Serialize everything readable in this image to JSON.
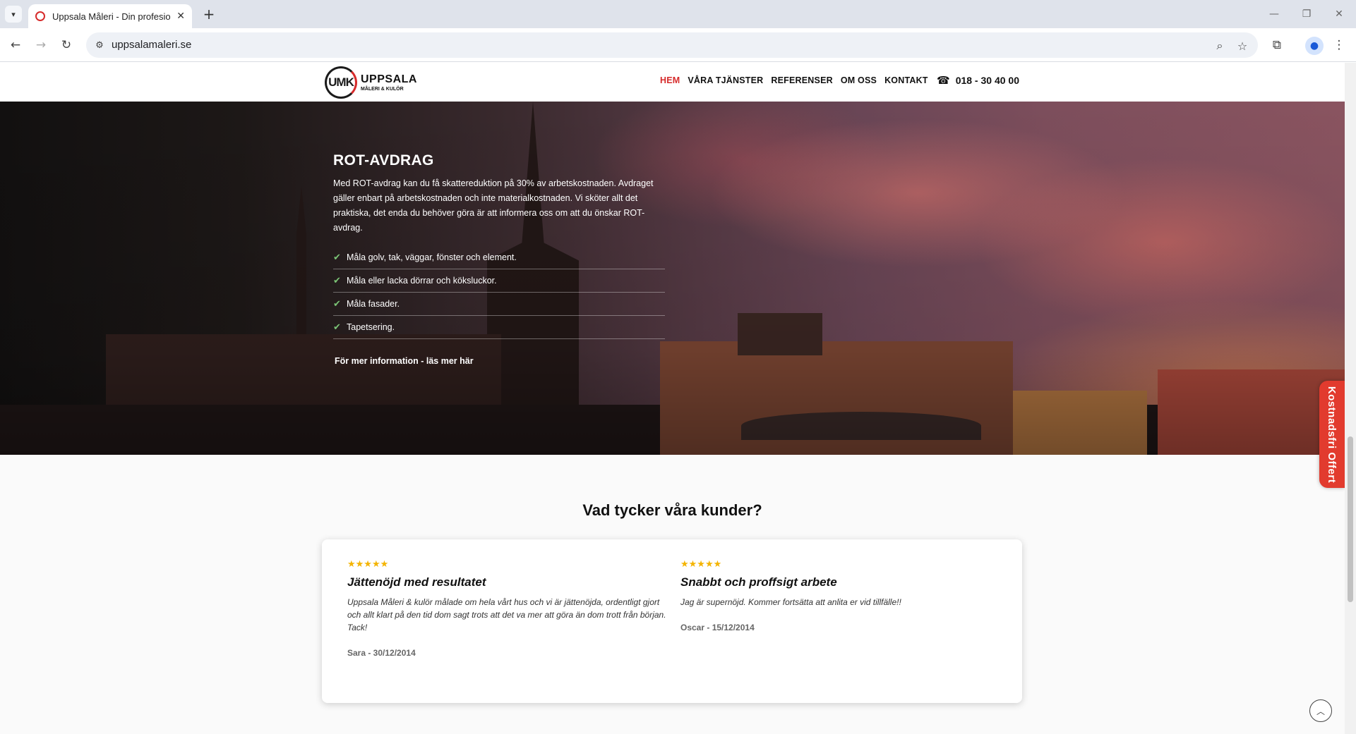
{
  "browser": {
    "tab_title": "Uppsala Måleri - Din profesionell",
    "url": "uppsalamaleri.se",
    "icons": {
      "tab_menu": "chevron-down-icon",
      "close_tab": "close-icon",
      "new_tab": "plus-icon",
      "back": "arrow-left-icon",
      "forward": "arrow-right-icon",
      "reload": "reload-icon",
      "site_info": "tune-icon",
      "zoom": "zoom-icon",
      "bookmark": "star-icon",
      "extensions": "puzzle-icon",
      "profile": "person-icon",
      "menu": "kebab-icon"
    }
  },
  "header": {
    "logo": {
      "mark": "UMK",
      "line1": "UPPSALA",
      "line2": "MÅLERI & KULÖR"
    },
    "nav": [
      {
        "label": "HEM",
        "active": true
      },
      {
        "label": "VÅRA TJÄNSTER",
        "active": false
      },
      {
        "label": "REFERENSER",
        "active": false
      },
      {
        "label": "OM OSS",
        "active": false
      },
      {
        "label": "KONTAKT",
        "active": false
      }
    ],
    "phone": "018 - 30 40 00",
    "accent_color": "#d62b2b"
  },
  "hero": {
    "title": "ROT-AVDRAG",
    "text": "Med ROT-avdrag kan du få skattereduktion på 30% av arbetskostnaden. Avdraget gäller enbart på arbetskostnaden och inte materialkostnaden. Vi sköter allt det praktiska, det enda du behöver göra är att informera oss om att du önskar ROT-avdrag.",
    "items": [
      "Måla golv, tak, väggar, fönster och element.",
      "Måla eller lacka dörrar och köksluckor.",
      "Måla fasader.",
      "Tapetsering."
    ],
    "more_link": "För mer information - läs mer här"
  },
  "side_tab": {
    "label": "Kostnadsfri Offert",
    "color": "#e23b2e"
  },
  "reviews": {
    "heading": "Vad tycker våra kunder?",
    "items": [
      {
        "stars": "★★★★★",
        "rating": 5,
        "title": "Jättenöjd med resultatet",
        "text": "Uppsala Måleri & kulör målade om hela vårt hus och vi är jättenöjda, ordentligt gjort och allt klart på den tid dom sagt trots att det va mer att göra än dom trott från början. Tack!",
        "author": "Sara - 30/12/2014"
      },
      {
        "stars": "★★★★★",
        "rating": 5,
        "title": "Snabbt och proffsigt arbete",
        "text": "Jag är supernöjd. Kommer fortsätta att anlita er vid tillfälle!!",
        "author": "Oscar - 15/12/2014"
      }
    ]
  }
}
